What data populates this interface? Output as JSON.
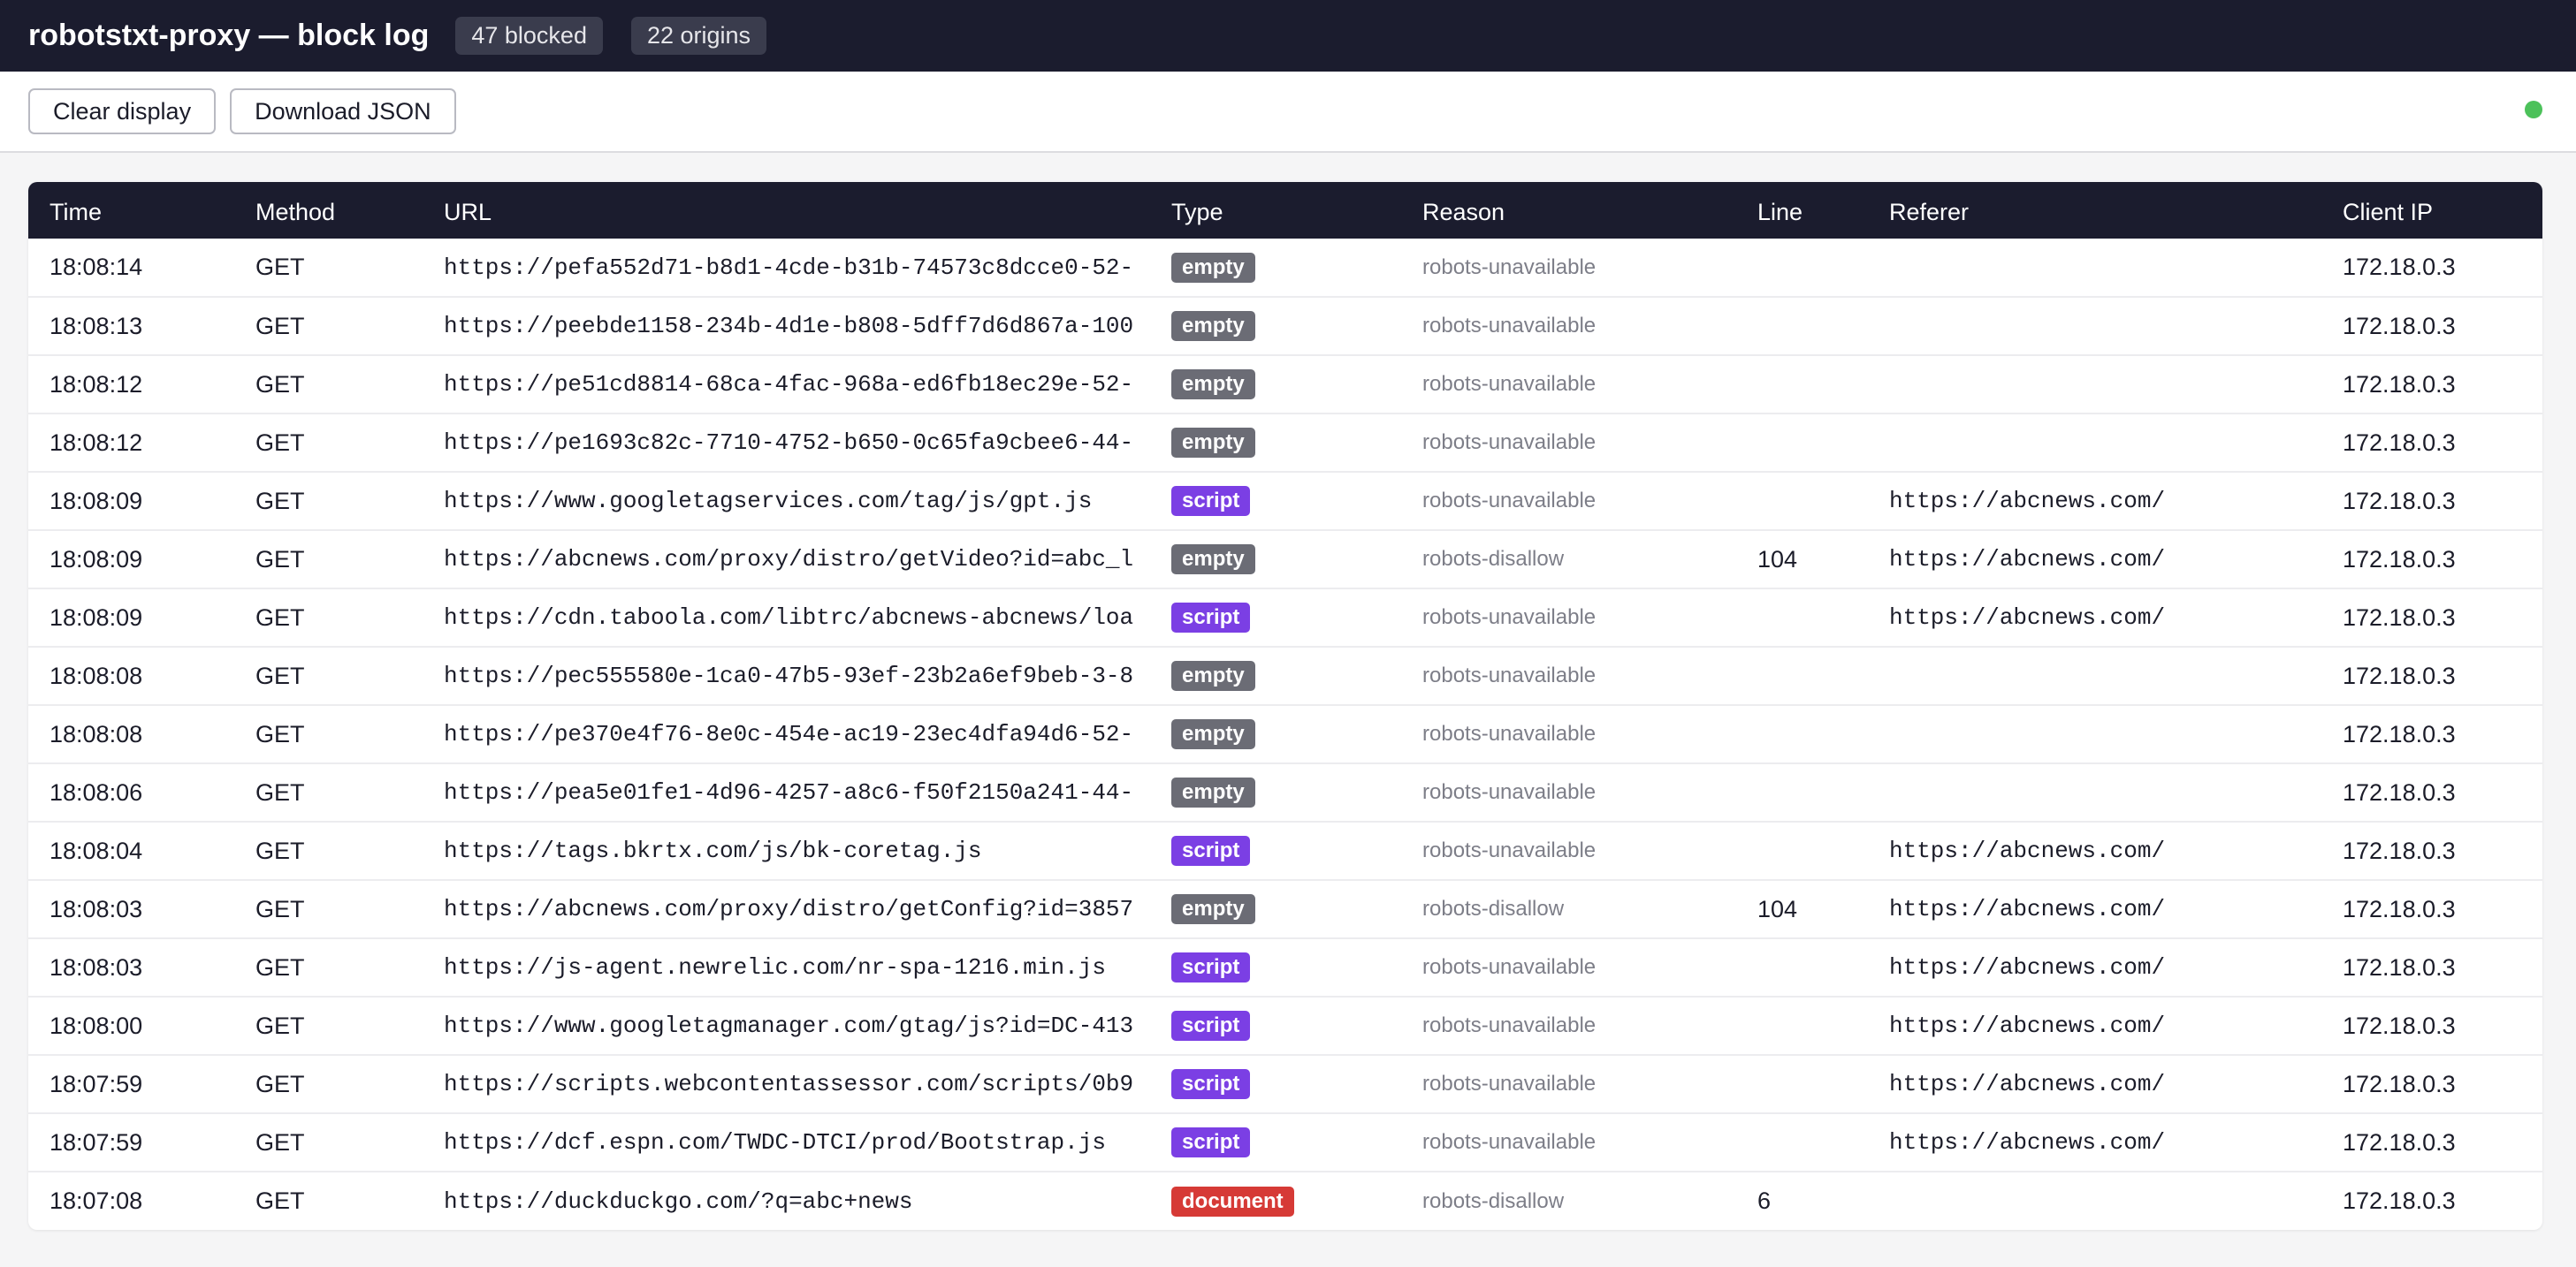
{
  "header": {
    "title": "robotstxt-proxy — block log",
    "blocked_badge": "47 blocked",
    "origins_badge": "22 origins"
  },
  "toolbar": {
    "clear_label": "Clear display",
    "download_label": "Download JSON",
    "status_color": "#4cc15a"
  },
  "table": {
    "columns": [
      "Time",
      "Method",
      "URL",
      "Type",
      "Reason",
      "Line",
      "Referer",
      "Client IP"
    ],
    "type_colors": {
      "empty": "#6b6c75",
      "script": "#7b3fe4",
      "document": "#d63a36"
    },
    "rows": [
      {
        "time": "18:08:14",
        "method": "GET",
        "url": "https://pefa552d71-b8d1-4cde-b31b-74573c8dcce0-52-",
        "type": "empty",
        "reason": "robots-unavailable",
        "line": "",
        "referer": "",
        "ip": "172.18.0.3"
      },
      {
        "time": "18:08:13",
        "method": "GET",
        "url": "https://peebde1158-234b-4d1e-b808-5dff7d6d867a-100",
        "type": "empty",
        "reason": "robots-unavailable",
        "line": "",
        "referer": "",
        "ip": "172.18.0.3"
      },
      {
        "time": "18:08:12",
        "method": "GET",
        "url": "https://pe51cd8814-68ca-4fac-968a-ed6fb18ec29e-52-",
        "type": "empty",
        "reason": "robots-unavailable",
        "line": "",
        "referer": "",
        "ip": "172.18.0.3"
      },
      {
        "time": "18:08:12",
        "method": "GET",
        "url": "https://pe1693c82c-7710-4752-b650-0c65fa9cbee6-44-",
        "type": "empty",
        "reason": "robots-unavailable",
        "line": "",
        "referer": "",
        "ip": "172.18.0.3"
      },
      {
        "time": "18:08:09",
        "method": "GET",
        "url": "https://www.googletagservices.com/tag/js/gpt.js",
        "type": "script",
        "reason": "robots-unavailable",
        "line": "",
        "referer": "https://abcnews.com/",
        "ip": "172.18.0.3"
      },
      {
        "time": "18:08:09",
        "method": "GET",
        "url": "https://abcnews.com/proxy/distro/getVideo?id=abc_l",
        "type": "empty",
        "reason": "robots-disallow",
        "line": "104",
        "referer": "https://abcnews.com/",
        "ip": "172.18.0.3"
      },
      {
        "time": "18:08:09",
        "method": "GET",
        "url": "https://cdn.taboola.com/libtrc/abcnews-abcnews/loa",
        "type": "script",
        "reason": "robots-unavailable",
        "line": "",
        "referer": "https://abcnews.com/",
        "ip": "172.18.0.3"
      },
      {
        "time": "18:08:08",
        "method": "GET",
        "url": "https://pec555580e-1ca0-47b5-93ef-23b2a6ef9beb-3-8",
        "type": "empty",
        "reason": "robots-unavailable",
        "line": "",
        "referer": "",
        "ip": "172.18.0.3"
      },
      {
        "time": "18:08:08",
        "method": "GET",
        "url": "https://pe370e4f76-8e0c-454e-ac19-23ec4dfa94d6-52-",
        "type": "empty",
        "reason": "robots-unavailable",
        "line": "",
        "referer": "",
        "ip": "172.18.0.3"
      },
      {
        "time": "18:08:06",
        "method": "GET",
        "url": "https://pea5e01fe1-4d96-4257-a8c6-f50f2150a241-44-",
        "type": "empty",
        "reason": "robots-unavailable",
        "line": "",
        "referer": "",
        "ip": "172.18.0.3"
      },
      {
        "time": "18:08:04",
        "method": "GET",
        "url": "https://tags.bkrtx.com/js/bk-coretag.js",
        "type": "script",
        "reason": "robots-unavailable",
        "line": "",
        "referer": "https://abcnews.com/",
        "ip": "172.18.0.3"
      },
      {
        "time": "18:08:03",
        "method": "GET",
        "url": "https://abcnews.com/proxy/distro/getConfig?id=3857",
        "type": "empty",
        "reason": "robots-disallow",
        "line": "104",
        "referer": "https://abcnews.com/",
        "ip": "172.18.0.3"
      },
      {
        "time": "18:08:03",
        "method": "GET",
        "url": "https://js-agent.newrelic.com/nr-spa-1216.min.js",
        "type": "script",
        "reason": "robots-unavailable",
        "line": "",
        "referer": "https://abcnews.com/",
        "ip": "172.18.0.3"
      },
      {
        "time": "18:08:00",
        "method": "GET",
        "url": "https://www.googletagmanager.com/gtag/js?id=DC-413",
        "type": "script",
        "reason": "robots-unavailable",
        "line": "",
        "referer": "https://abcnews.com/",
        "ip": "172.18.0.3"
      },
      {
        "time": "18:07:59",
        "method": "GET",
        "url": "https://scripts.webcontentassessor.com/scripts/0b9",
        "type": "script",
        "reason": "robots-unavailable",
        "line": "",
        "referer": "https://abcnews.com/",
        "ip": "172.18.0.3"
      },
      {
        "time": "18:07:59",
        "method": "GET",
        "url": "https://dcf.espn.com/TWDC-DTCI/prod/Bootstrap.js",
        "type": "script",
        "reason": "robots-unavailable",
        "line": "",
        "referer": "https://abcnews.com/",
        "ip": "172.18.0.3"
      },
      {
        "time": "18:07:08",
        "method": "GET",
        "url": "https://duckduckgo.com/?q=abc+news",
        "type": "document",
        "reason": "robots-disallow",
        "line": "6",
        "referer": "",
        "ip": "172.18.0.3"
      }
    ]
  }
}
